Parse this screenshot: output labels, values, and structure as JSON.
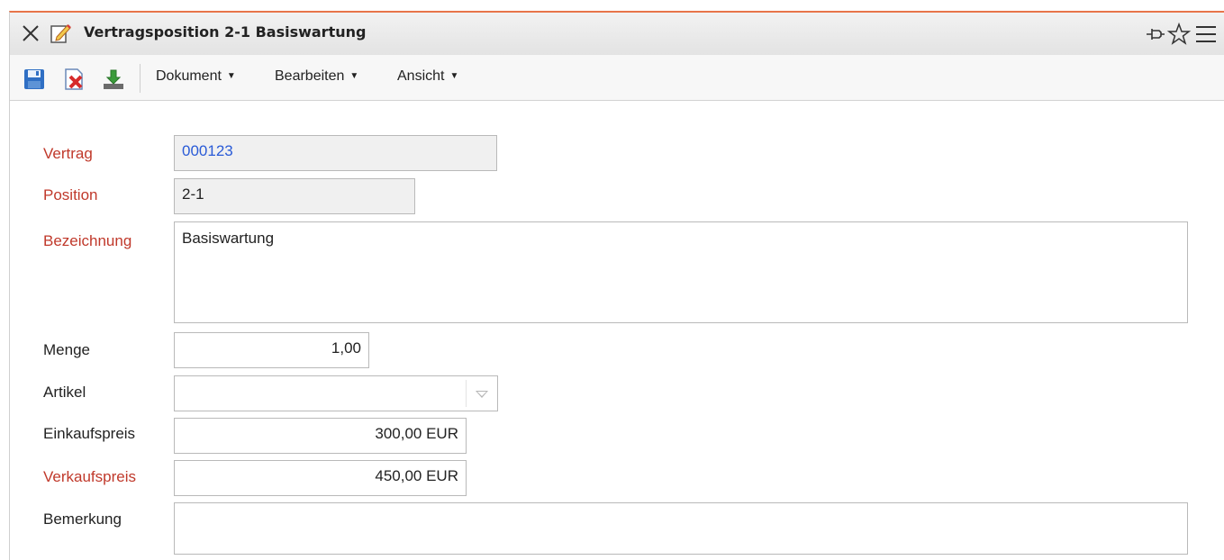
{
  "window": {
    "title": "Vertragsposition 2-1 Basiswartung",
    "accent_color": "#e8754a",
    "icons": [
      "close-icon",
      "edit-document-icon",
      "pin-icon",
      "star-icon",
      "hamburger-menu-icon"
    ]
  },
  "toolbar": {
    "buttons": [
      "save-icon",
      "delete-icon",
      "download-icon"
    ],
    "menus": {
      "dokument": "Dokument",
      "bearbeiten": "Bearbeiten",
      "ansicht": "Ansicht"
    }
  },
  "form": {
    "required_label_color": "#c0392b",
    "vertrag": {
      "label": "Vertrag",
      "value": "000123"
    },
    "position": {
      "label": "Position",
      "value": "2-1"
    },
    "bezeichnung": {
      "label": "Bezeichnung",
      "value": "Basiswartung"
    },
    "menge": {
      "label": "Menge",
      "value": "1,00"
    },
    "artikel": {
      "label": "Artikel",
      "value": ""
    },
    "einkaufspreis": {
      "label": "Einkaufspreis",
      "value": "300,00 EUR"
    },
    "verkaufspreis": {
      "label": "Verkaufspreis",
      "value": "450,00 EUR"
    },
    "bemerkung": {
      "label": "Bemerkung",
      "value": ""
    }
  }
}
